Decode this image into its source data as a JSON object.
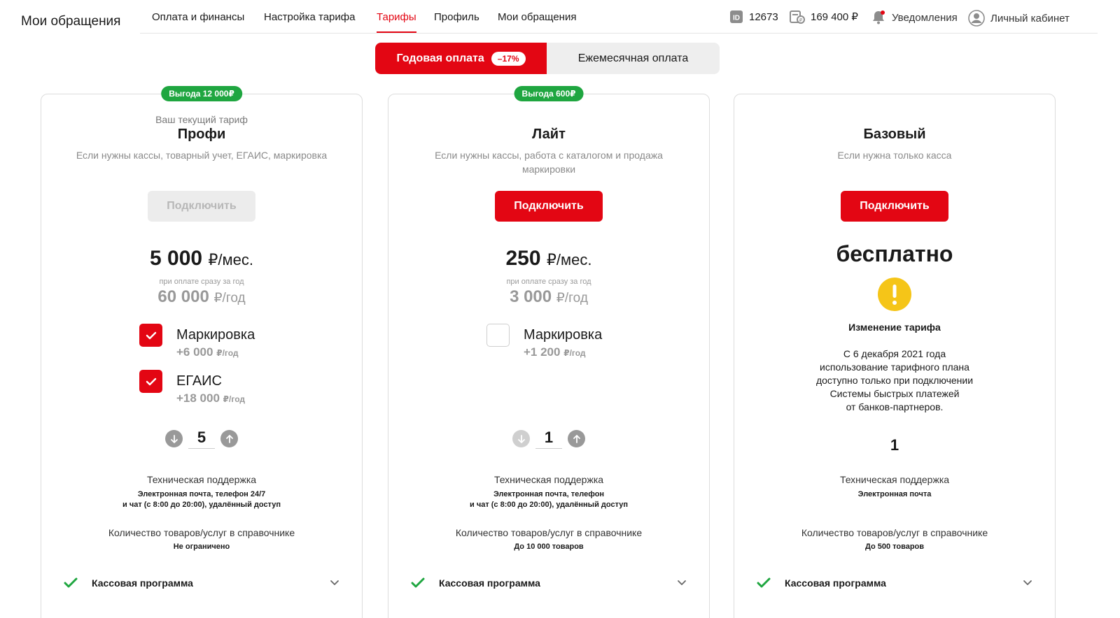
{
  "header": {
    "title": "Мои обращения",
    "nav": [
      "Оплата и финансы",
      "Настройка тарифа",
      "Тарифы",
      "Профиль",
      "Мои обращения"
    ],
    "active_nav": "Тарифы",
    "account_id": "12673",
    "balance": "169 400 ₽",
    "notifications": "Уведомления",
    "cabinet": "Личный кабинет"
  },
  "billing": {
    "yearly_label": "Годовая оплата",
    "discount": "–17%",
    "monthly_label": "Ежемесячная оплата",
    "selected": "yearly"
  },
  "plans": [
    {
      "badge": "Выгода 12 000₽",
      "current_label": "Ваш текущий тариф",
      "name": "Профи",
      "description": "Если нужны кассы, товарный учет, ЕГАИС, маркировка",
      "button": "Подключить",
      "button_enabled": false,
      "price": "5 000",
      "price_unit": "₽/мес.",
      "price_note": "при оплате сразу за год",
      "price_year": "60 000",
      "price_year_unit": "₽/год",
      "options": [
        {
          "title": "Маркировка",
          "price": "+6 000",
          "unit": "₽/год",
          "checked": true
        },
        {
          "title": "ЕГАИС",
          "price": "+18 000",
          "unit": "₽/год",
          "checked": true
        }
      ],
      "count": "5",
      "support_label": "Техническая поддержка",
      "support_line1": "Электронная почта, телефон 24/7",
      "support_line2": "и чат (с 8:00 до 20:00), удалённый доступ",
      "goods_label": "Количество товаров/услуг в справочнике",
      "goods_value": "Не ограничено",
      "feature": "Кассовая программа"
    },
    {
      "badge": "Выгода 600₽",
      "name": "Лайт",
      "description": "Если нужны кассы, работа с каталогом и продажа маркировки",
      "button": "Подключить",
      "button_enabled": true,
      "price": "250",
      "price_unit": "₽/мес.",
      "price_note": "при оплате сразу за год",
      "price_year": "3 000",
      "price_year_unit": "₽/год",
      "options": [
        {
          "title": "Маркировка",
          "price": "+1 200",
          "unit": "₽/год",
          "checked": false
        }
      ],
      "count": "1",
      "support_label": "Техническая поддержка",
      "support_line1": "Электронная почта, телефон",
      "support_line2": "и чат (с 8:00 до 20:00), удалённый доступ",
      "goods_label": "Количество товаров/услуг в справочнике",
      "goods_value": "До 10 000 товаров",
      "feature": "Кассовая программа"
    },
    {
      "name": "Базовый",
      "description": "Если нужна только касса",
      "button": "Подключить",
      "button_enabled": true,
      "price_text": "бесплатно",
      "warning_title": "Изменение тарифа",
      "warning_lines": [
        "С 6 декабря 2021 года",
        "использование тарифного плана",
        "доступно только при подключении",
        "Системы быстрых платежей",
        "от банков-партнеров."
      ],
      "count": "1",
      "support_label": "Техническая поддержка",
      "support_line1": "Электронная почта",
      "goods_label": "Количество товаров/услуг в справочнике",
      "goods_value": "До 500 товаров",
      "feature": "Кассовая программа"
    }
  ],
  "colors": {
    "accent": "#e30613",
    "badge_green": "#1fa640",
    "check_green": "#1fa640",
    "warning_yellow": "#f5c518"
  },
  "icons": [
    "id-icon",
    "wallet-icon",
    "bell-icon",
    "user-icon",
    "check-icon",
    "arrow-down-icon",
    "arrow-up-icon",
    "warning-icon",
    "chevron-down-icon"
  ]
}
